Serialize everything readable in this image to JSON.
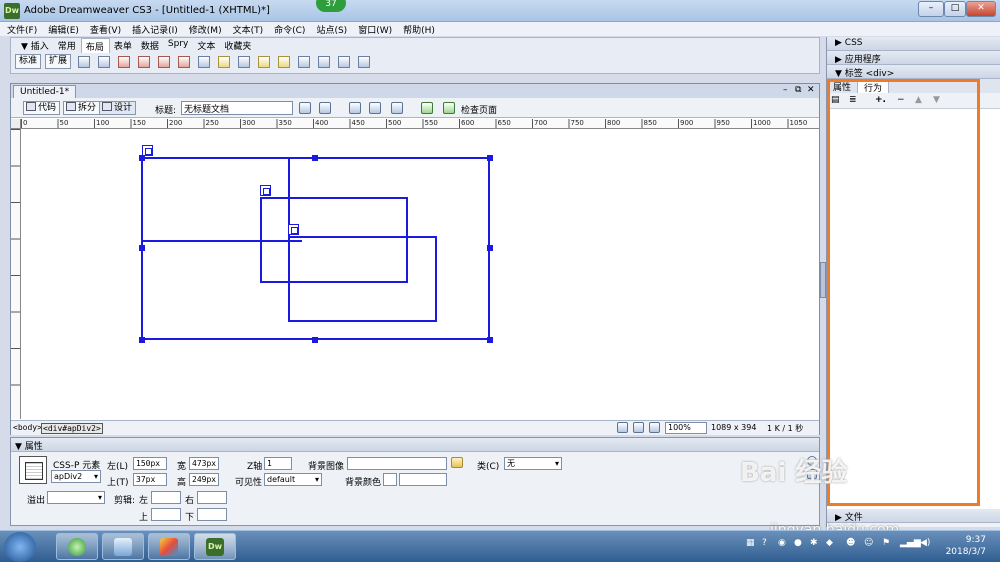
{
  "window": {
    "title": "Adobe Dreamweaver CS3 - [Untitled-1 (XHTML)*]",
    "logo_text": "Dw",
    "badge": "37",
    "controls": [
      "–",
      "□",
      "✕"
    ]
  },
  "menu": [
    "文件(F)",
    "编辑(E)",
    "查看(V)",
    "插入记录(I)",
    "修改(M)",
    "文本(T)",
    "命令(C)",
    "站点(S)",
    "窗口(W)",
    "帮助(H)"
  ],
  "insert_bar": {
    "label": "▼ 插入",
    "tabs": [
      "常用",
      "布局",
      "表单",
      "数据",
      "Spry",
      "文本",
      "收藏夹"
    ],
    "active_tab": "布局",
    "mode_buttons": [
      "标准",
      "扩展"
    ]
  },
  "document": {
    "tab_label": "Untitled-1*",
    "tab_controls": [
      "–",
      "⧉",
      "✕"
    ],
    "view_buttons": [
      "代码",
      "拆分",
      "设计"
    ],
    "title_label": "标题:",
    "title_value": "无标题文档",
    "check_page_label": "检查页面",
    "ruler_ticks": [
      "0",
      "50",
      "100",
      "150",
      "200",
      "250",
      "300",
      "350",
      "400",
      "450",
      "500",
      "550",
      "600",
      "650",
      "700",
      "750",
      "800",
      "850",
      "900",
      "950",
      "1000",
      "1050"
    ]
  },
  "statusbar": {
    "tag_body": "<body>",
    "tag_div": "<div#apDiv2>",
    "zoom": "100%",
    "size": "1089 x 394",
    "download": "1 K / 1 秒"
  },
  "properties": {
    "header": "▼ 属性",
    "element_type": "CSS-P 元素",
    "element_id": "apDiv2",
    "left_label": "左(L)",
    "left_value": "150px",
    "top_label": "上(T)",
    "top_value": "37px",
    "width_label": "宽",
    "width_value": "473px",
    "height_label": "高",
    "height_value": "249px",
    "z_label": "Z轴",
    "z_value": "1",
    "visibility_label": "可见性",
    "visibility_value": "default",
    "bgimage_label": "背景图像",
    "bgcolor_label": "背景颜色",
    "class_label": "类(C)",
    "class_value": "无",
    "overflow_label": "溢出",
    "clip_label": "剪辑:",
    "clip_left": "左",
    "clip_right": "右",
    "clip_top": "上",
    "clip_bottom": "下"
  },
  "right_panel": {
    "rows": [
      "▶ CSS",
      "▶ 应用程序",
      "▼ 标签 <div>"
    ],
    "tabs": [
      "属性",
      "行为"
    ],
    "active_tab": "行为",
    "files_row": "▶ 文件"
  },
  "watermark": {
    "text": "Bai 经验",
    "url": "jingyan.baidu.com"
  },
  "taskbar": {
    "dw_label": "Dw",
    "clock_time": "9:37",
    "clock_date": "2018/3/7"
  },
  "colors": {
    "apdiv_border": "#1a1ae0",
    "highlight": "#f07b27"
  }
}
